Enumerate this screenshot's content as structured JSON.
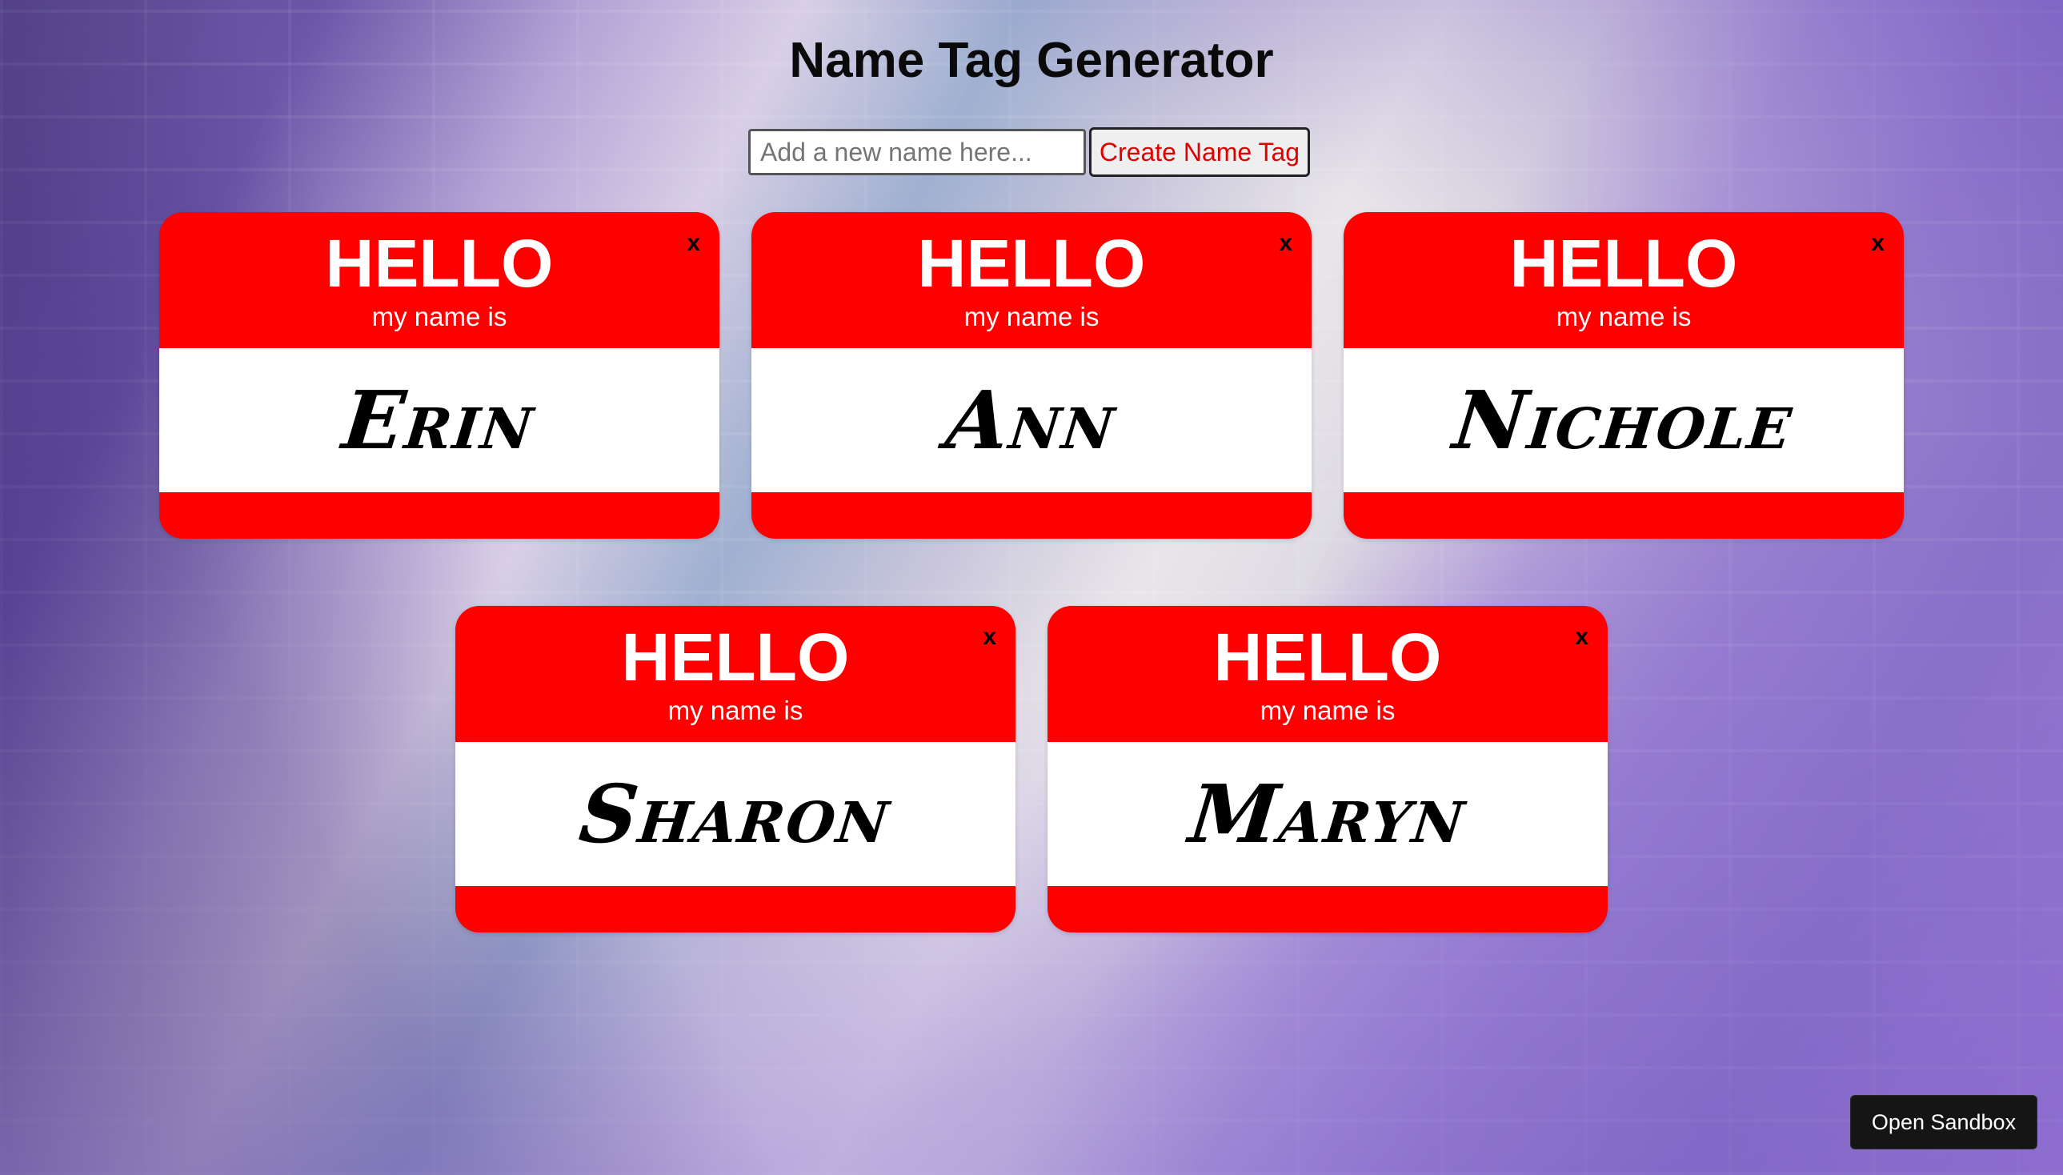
{
  "page": {
    "title": "Name Tag Generator"
  },
  "form": {
    "input_value": "",
    "input_placeholder": "Add a new name here...",
    "button_label": "Create Name Tag"
  },
  "tag_template": {
    "greeting": "HELLO",
    "subtitle": "my name is",
    "close_label": "x"
  },
  "tags": [
    {
      "name": "Erin"
    },
    {
      "name": "Ann"
    },
    {
      "name": "Nichole"
    },
    {
      "name": "Sharon"
    },
    {
      "name": "Maryn"
    }
  ],
  "sandbox": {
    "label": "Open Sandbox"
  },
  "colors": {
    "tag_red": "#ff0000",
    "button_text_red": "#e00000",
    "sandbox_bg": "#151515"
  }
}
